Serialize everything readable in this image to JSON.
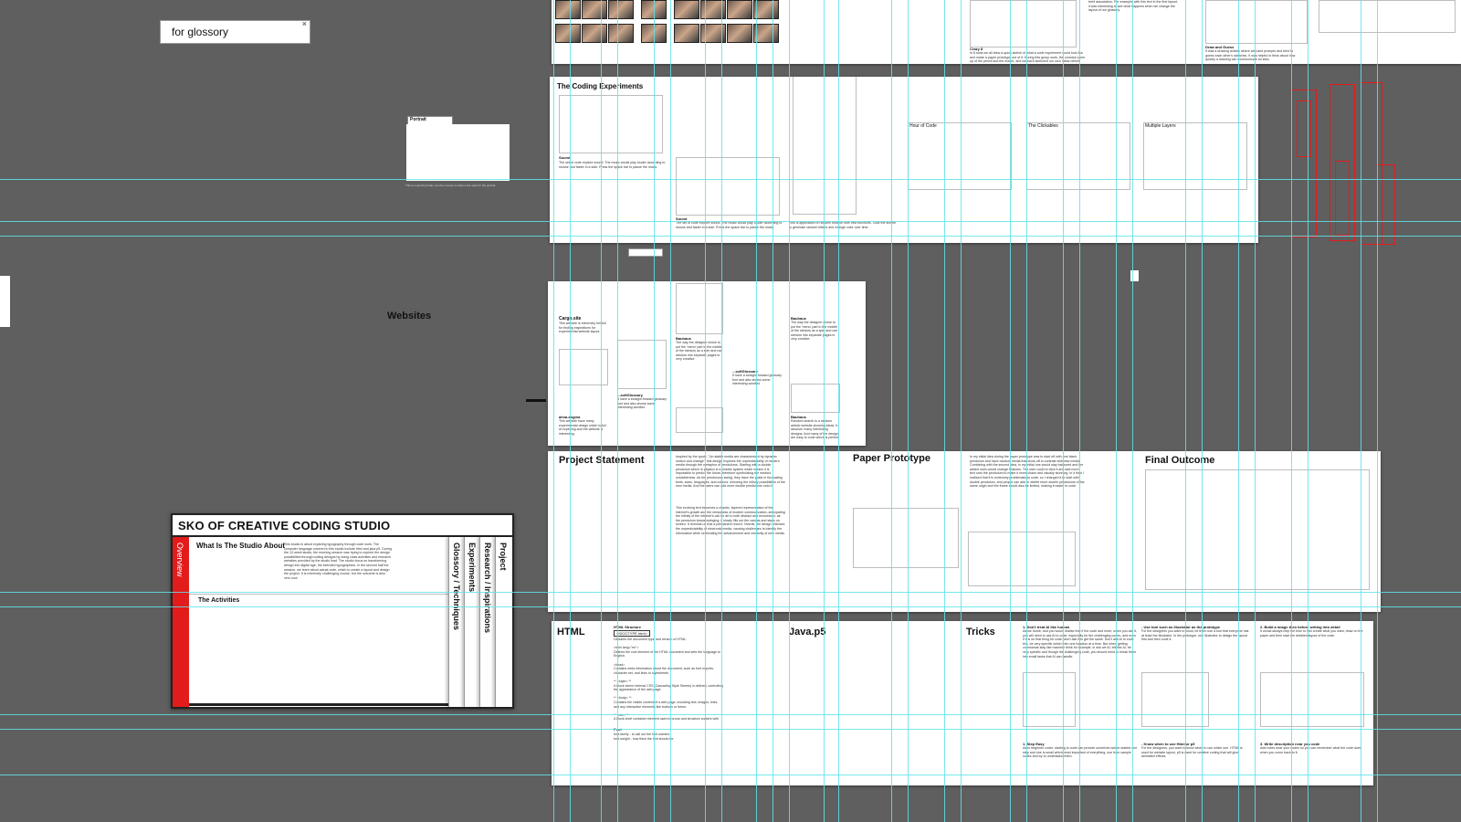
{
  "search": {
    "value": "for glossory",
    "close_glyph": "×"
  },
  "canvas": {
    "portrait_tab": "Portrait",
    "portrait_caption": "This is a pencil portrait, use the moouse to draw a line style for the portrait.",
    "websites_label": "Websites"
  },
  "top_board": {
    "crazy8_label": "Crazy 8",
    "crazy8_text": "In 8 slots we all drew a quick sketch of what a code experiment could look like and made a paper prototype out of it. During this group work, the concept came up of the pencil and the eraser, and we each sketched our own ideas before choosing a direction that felt most playful.",
    "draw_guess_label": "Draw and Guess",
    "draw_guess_text": "It was a drawing activity where we used prompts and tried to guess each other's sketches. It was helpful to think about how quickly a drawing can communicate an idea.",
    "top_text": "brief association. For example, with this text in the first layout, it was interesting to see what happens when we change the layout of our glossary."
  },
  "coding_experiments": {
    "title": "The Coding Experiments",
    "sound_label": "Sound",
    "sound_text": "The set of code explore sound. The music would play louder according to mouse and faster in a side. Press the space bar to pause the music.",
    "sound2_label": "Sound",
    "sound2_text": "The set of code explore sound. The music would play louder according to mouse and faster in a side. Press the space bar to pause the music.",
    "application_text": "This is application of random function with new functions. Click the screen to generate random letters and change color over time.",
    "hour_of_code": "Hour of Code",
    "clickables": "The Clickables",
    "multiple_layers": "Multiple Layers"
  },
  "websites_board": {
    "cargo_label": "Cargo.site",
    "cargo_text": "This website is extremely helpful for finding inspirations for experimental website layout.",
    "bauhaus_label": "Bauhaus",
    "bauhaus_text": "The way the designer chose to put the 'menu' part in the middle of the window as a spin and use window into separate pages is very creative.",
    "bauhaus_right_label": "Bauhaus",
    "bauhaus_right_text": "The way the designer chose to put the 'menu' part in the middle of the window as a spin and use window into separate pages is very creative.",
    "glossary_label": "...softGlossary",
    "glossary_text": "It have a straight forward glossary font and also shows some interesting wordlist.",
    "glossary2_label": "...softGlossary",
    "glossary2_text": "It have a straight forward glossary font and also shows some interesting wordlist.",
    "alma_label": "alma-angina",
    "alma_text": "This website have many experimental design which is full of exploring and the website is interesting.",
    "bauhaus_bottom_label": "Bauhaus",
    "bauhaus_bottom_text": "Random search is a random artistic website showing ideas. It discover many interesting designs. And many of the design are easy to code which is perfect inspiration."
  },
  "project_board": {
    "statement_title": "Project  Statement",
    "statement_text": "Inspired by the quote, \"Un-stable media are characterised by dynamic motion and change\", this design explores the unpredictability of modern media through the metaphor of pendulums. Starting with a double pendulum which in physics is a chaotic system which means it is impossible to predict the future, therefore symbolizing the media's unstableness. As the pendulums swing, they trace the guide in fluctuating fonts, sizes, languages, and colours, mirroring the infinity possibilities of the new media. And the users can add more double pendulums onto it.",
    "statement_text2": "This evolving text becomes a chaotic, layered representation of the internet's growth and the messiness of modern communication, anticipating the infinity of the internet's call for art to both distract and reconstruct, as the pendulum keeps swinging, it slowly fills out the canvas and stays on screen. It reminds us that a permanent record. Overall, the design criticises the unpredictability of electronic media, causing challenges to identify the information while celebrating the advancement and creativity of new media.",
    "paper_title": "Paper Prototype",
    "paper_text": "In my initial idea during the paper prototype was to start off with one black pendulum and have random media that show off in contrast with new media. Combining with the second idea, in my initial one would stay balanced and the added ones would change features. The user could to click it and add more text onto the pendulum to make it more chaos and visually stunning. In it then I realised that it is extremely problematic to code, so I changed it to start with double pendulum, and people can add or delete more double pendulums of the same origin and the frame would also be limited, making it easier to code.",
    "final_title": "Final Outcome"
  },
  "glossary_board": {
    "html_title": "HTML",
    "java_title": "Java.p5",
    "tricks_title": "Tricks",
    "html_structure": "HTML Structure",
    "html_tag": "<!DOCTYPE html>",
    "html_text": "Declares the document type and version of HTML.\n\n<html lang=\"en\">\nDefines the root element of the HTML document and sets the language to English.\n\n<head>\nContains meta information about the document, such as font imports, character set, and links to stylesheets.\n\n** <style> **\nA block where internal CSS (Cascading Style Sheets) is defined, controlling the appearance of the web page.\n\n** <body> **\nContains the visible content of a web page, including text, images, links, and any interactive elements like buttons or forms.\n\n** <div> **\nA block-level container element used to group and structure content with styling. It allows for the division of the page into multiple sections.",
    "font_label": "Font",
    "font_text": "font-family - to call out the font wanted.\nfont-weight - how thick the font should be.",
    "trick1": "1. Don't treat AI like human",
    "trick1_text": "As we dumb, and you would realise that if the code and more, when you ask it, you will need to ask AI to code, especially for the challenging codes, and even if it is on that thing for code, don't ask it to get the same. Don't ask AI to code this, be very specific which then one function at a time. But when getting commands stay like machine think for example, in ask we AI, tell like AI, be very specific and though the challenging code, you should need to break them into small tasks that AI can handle.",
    "trick2": "- Use tool such as Illustrator as the prototype",
    "trick2_text": "For the designers you want to know, let them use a tool that everyone has at least the Illustrator. In the prototype, use Illustrator to design the layout first and then code it.",
    "trick3": "2. Build a image then before writing into detail",
    "trick3_text": "It would always help the time to first create what you want, draw on the paper and then start the detailed layout of the code.",
    "trick4": "1. Step Easy",
    "trick4_text": "As to beginner coder, starting to code can provide ourselves where started one step and one is small which most important of everything, use from sample codes and try to understand them.",
    "trick5": "- Know when to use Html or p5",
    "trick5_text": "For the designers, you want to know when to use which one. HTML is used for website layout, p5 is used for creative coding that will give animated effects.",
    "trick6": "3. Write description near you code",
    "trick6_text": "Add notes near your codes so you can remember what the code does when you come back to it."
  },
  "studio": {
    "title": "SKO OF CREATIVE CODING STUDIO",
    "overview_tab": "Overview",
    "about_heading": "What Is The Studio About",
    "about_text": "This studio is about exploring typography through code work. The computer language covered in this studio include html and java p5. During the 12-week studio, the morning session was trying to explore the design possibilities through coding designs by doing class activities and research websites provided by the studio lead. The studio focus on transforming design into digital age, the intended typographies. In the second half the session, we learn about actual code, which to create a layout and design the project. It is extremely challenging course, but the outcome is also very cool.",
    "activities_heading": "The Activities",
    "tabs": [
      "Glossory / Techniques",
      "Experiments",
      "Research / Inspirations",
      "Project"
    ]
  }
}
